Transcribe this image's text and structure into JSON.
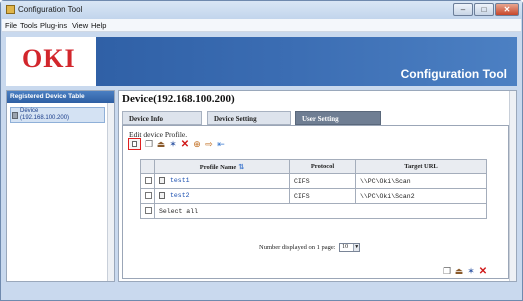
{
  "window": {
    "title": "Configuration Tool",
    "min_glyph": "–",
    "max_glyph": "□",
    "close_glyph": "✕"
  },
  "menu": {
    "items": [
      "File",
      "Tools",
      "Plug-ins",
      "View",
      "Help"
    ]
  },
  "banner": {
    "logo": "OKI",
    "title": "Configuration Tool",
    "accent": "#d2262c",
    "brand_blue": "#2a5aa0"
  },
  "left_panel": {
    "header": "Registered Device Table",
    "device_name": "Device",
    "device_ip": "(192.168.100.200)"
  },
  "main": {
    "device_title": "Device(192.168.100.200)",
    "tabs": [
      {
        "label": "Device Info",
        "active": false
      },
      {
        "label": "Device Setting",
        "active": false
      },
      {
        "label": "User Setting",
        "active": true
      }
    ],
    "caption": "Edit device Profile.",
    "toolbar_icons": [
      "edit-profile-icon",
      "copy-icon",
      "import-icon",
      "wand-icon",
      "delete-icon",
      "add-icon",
      "export-icon",
      "arrange-icon"
    ],
    "table": {
      "columns": [
        "",
        "Profile Name",
        "Protocol",
        "Target URL"
      ],
      "rows": [
        {
          "name": "test1",
          "protocol": "CIFS",
          "url": "\\\\PC\\Oki\\Scan"
        },
        {
          "name": "test2",
          "protocol": "CIFS",
          "url": "\\\\PC\\Oki\\Scan2"
        }
      ],
      "select_all": "Select all"
    },
    "paging": {
      "label": "Number displayed on 1 page:",
      "value": "10"
    },
    "bottom_icons": [
      "copy-icon",
      "import-icon",
      "wand-icon",
      "delete-icon"
    ]
  }
}
